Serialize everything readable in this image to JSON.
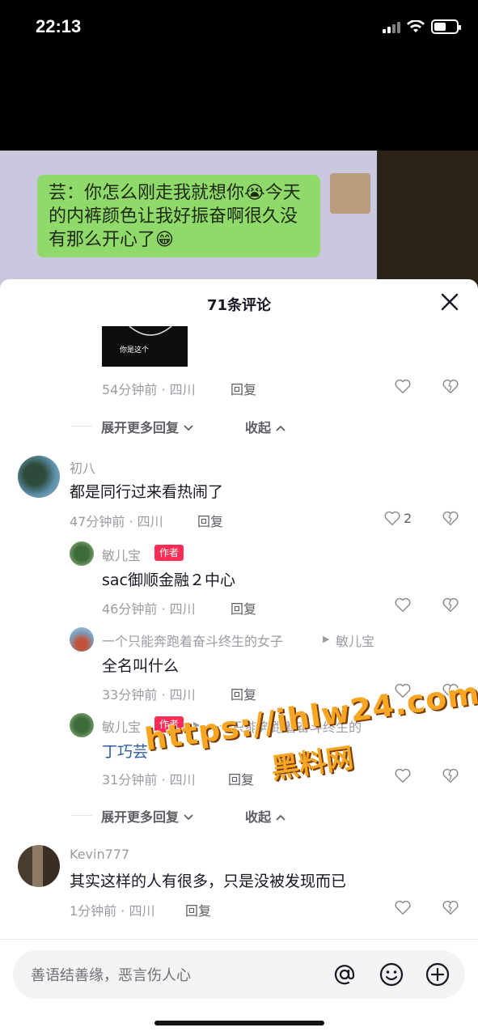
{
  "status_bar": {
    "time": "22:13"
  },
  "video": {
    "chat_text": "芸：你怎么刚走我就想你😭今天的内裤颜色让我好振奋啊很久没有那么开心了😁"
  },
  "sheet": {
    "title": "71条评论"
  },
  "thread0": {
    "image_caption": "你是这个",
    "meta": "54分钟前 · 四川",
    "reply": "回复",
    "expand": "展开更多回复",
    "collapse": "收起"
  },
  "comments": [
    {
      "username": "初八",
      "text": "都是同行过来看热闹了",
      "meta": "47分钟前 · 四川",
      "reply": "回复",
      "likes": "2",
      "replies": [
        {
          "username": "敏儿宝",
          "badge": "作者",
          "text": "sac御顺金融２中心",
          "meta": "46分钟前 · 四川",
          "reply": "回复"
        },
        {
          "username": "一个只能奔跑着奋斗终生的女子",
          "reply_to": "敏儿宝",
          "text": "全名叫什么",
          "meta": "33分钟前 · 四川",
          "reply": "回复"
        },
        {
          "username": "敏儿宝",
          "badge": "作者",
          "reply_to": "一个只能奔跑着奋斗终生的",
          "text": "丁巧芸",
          "meta": "31分钟前 · 四川",
          "reply": "回复"
        }
      ],
      "expand": "展开更多回复",
      "collapse": "收起"
    },
    {
      "username": "Kevin777",
      "text": "其实这样的人有很多，只是没被发现而已",
      "meta": "1分钟前 · 四川",
      "reply": "回复"
    }
  ],
  "watermark": {
    "url": "https://ihlw24.com",
    "name": "黑料网"
  },
  "input": {
    "placeholder": "善语结善缘，恶言伤人心"
  },
  "icons": [
    "heart-icon",
    "broken-heart-icon",
    "close-icon",
    "at-icon",
    "emoji-icon",
    "plus-icon",
    "search-icon"
  ],
  "colors": {
    "accent": "#fe2c55",
    "link": "#2a5ea6",
    "watermark": "#f6a623"
  }
}
